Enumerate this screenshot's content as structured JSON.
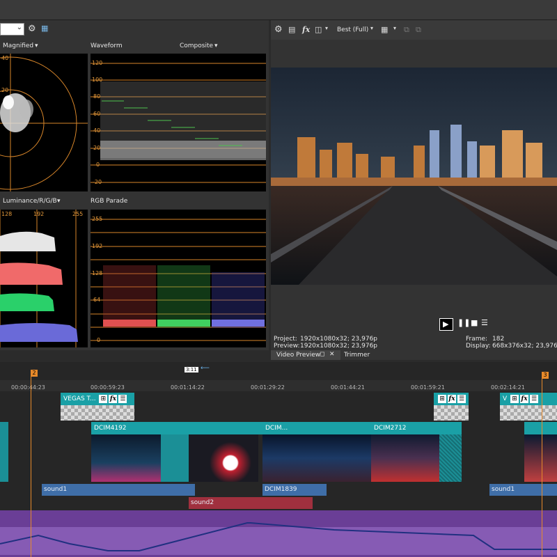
{
  "scopes": {
    "vectorscope": {
      "label": "Magnified",
      "ticks": [
        "40",
        "20"
      ]
    },
    "waveform": {
      "label": "Waveform",
      "mode": "Composite",
      "ticks": [
        "120",
        "100",
        "80",
        "60",
        "40",
        "20",
        "0",
        "-20"
      ]
    },
    "histogram": {
      "label": "Luminance/R/G/B",
      "ticks": [
        "128",
        "192",
        "255"
      ]
    },
    "parade": {
      "label": "RGB Parade",
      "ticks": [
        "255",
        "192",
        "128",
        "64",
        "0"
      ]
    }
  },
  "preview": {
    "quality": "Best (Full)",
    "project_label": "Project:",
    "project_value": "1920x1080x32; 23,976p",
    "preview_label": "Preview:",
    "preview_value": "1920x1080x32; 23,976p",
    "frame_label": "Frame:",
    "frame_value": "182",
    "display_label": "Display:",
    "display_value": "668x376x32; 23,976",
    "tabs": [
      "Video Preview",
      "Trimmer"
    ]
  },
  "timeline": {
    "marker_left": "2",
    "marker_right": "3",
    "region_label": "3:11",
    "times": [
      "00:00:44:23",
      "00:00:59:23",
      "00:01:14:22",
      "00:01:29:22",
      "00:01:44:21",
      "00:01:59:21",
      "00:02:14:21"
    ],
    "clips": {
      "title1": "VEGAS T...",
      "title2": "V",
      "v1": "DCIM4192",
      "v2": "DCIM...",
      "v3": "DCIM2712",
      "a1": "sound1",
      "a2": "DCIM1839",
      "a3": "sound1",
      "a4": "sound2"
    }
  },
  "colors": {
    "accent_orange": "#e88a2a",
    "clip_teal": "#1aa0a6",
    "audio_blue": "#3f6ea8",
    "audio_red": "#a0303e",
    "audio_purple": "#7a4ea6"
  }
}
